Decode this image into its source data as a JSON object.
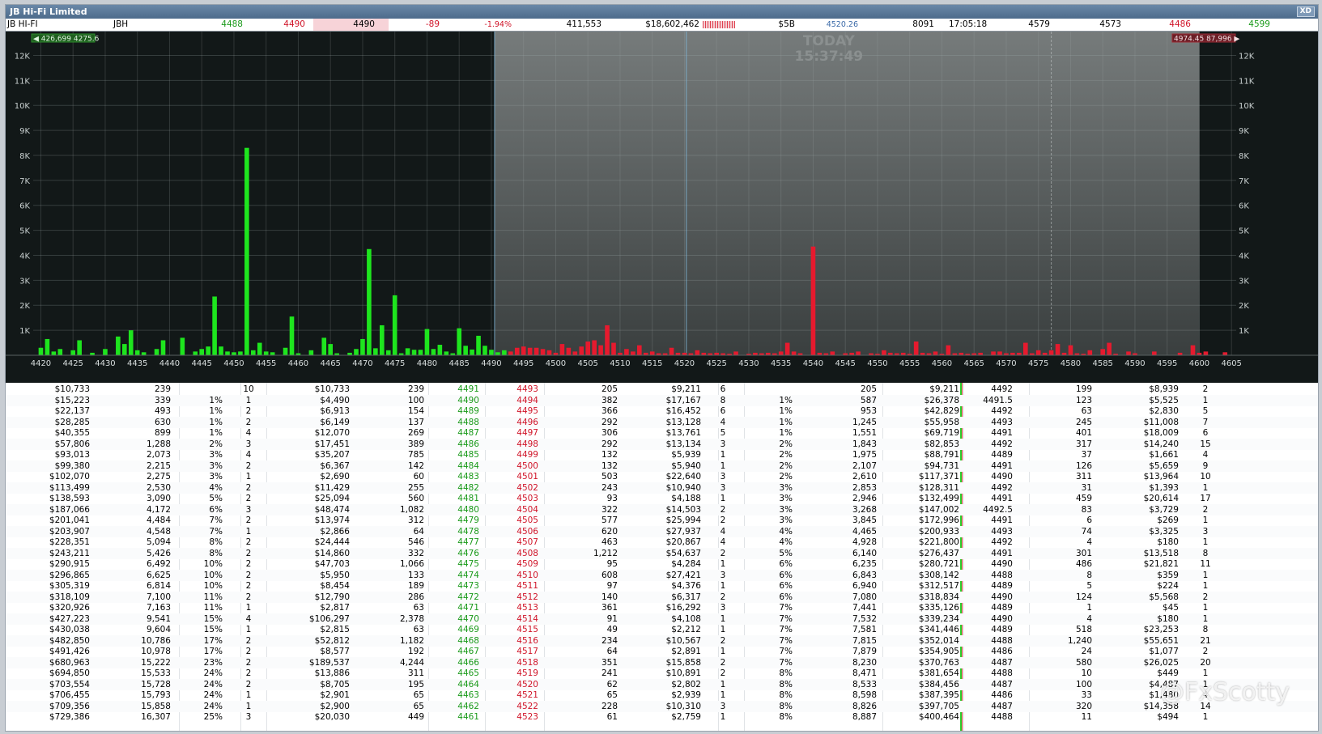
{
  "window": {
    "title": "JB Hi-Fi Limited",
    "xd_label": "XD"
  },
  "quote": {
    "name": "JB HI-FI",
    "code": "JBH",
    "bid": "4488",
    "ask": "4490",
    "last": "4490",
    "change": "-89",
    "change_pct": "-1.94%",
    "volume": "411,553",
    "value": "$18,602,462",
    "market_cap": "$5B",
    "vwap": "4520.26",
    "trades": "8091",
    "time": "17:05:18",
    "high": "4579",
    "open": "4573",
    "low": "4486",
    "prev_close": "4599"
  },
  "chart": {
    "today_label": "TODAY",
    "time_label": "15:37:49",
    "left_badge": "426,699 4275.6",
    "right_badge": "4974.45 87,996",
    "colors": {
      "buy": "#1ee51e",
      "sell": "#e61a2e",
      "bg": "#121818",
      "shade": "#6b7070"
    }
  },
  "chart_data": {
    "type": "bar",
    "x_range": [
      4419,
      4605
    ],
    "ylim": [
      0,
      12500
    ],
    "y_ticks": [
      1000,
      2000,
      3000,
      4000,
      5000,
      6000,
      7000,
      8000,
      9000,
      10000,
      11000,
      12000
    ],
    "y_tick_labels": [
      "1K",
      "2K",
      "3K",
      "4K",
      "5K",
      "6K",
      "7K",
      "8K",
      "9K",
      "10K",
      "11K",
      "12K"
    ],
    "x_ticks": [
      4420,
      4425,
      4430,
      4435,
      4440,
      4445,
      4450,
      4455,
      4460,
      4465,
      4470,
      4475,
      4480,
      4485,
      4490,
      4495,
      4500,
      4505,
      4510,
      4515,
      4520,
      4525,
      4530,
      4535,
      4540,
      4545,
      4550,
      4555,
      4560,
      4565,
      4570,
      4575,
      4580,
      4585,
      4590,
      4595,
      4600,
      4605
    ],
    "shaded_range": [
      4490.5,
      4600
    ],
    "vline_prices": [
      4490.5,
      4520.3
    ],
    "grid": true,
    "series": [
      {
        "side": "buy",
        "points": [
          [
            4420,
            300
          ],
          [
            4421,
            650
          ],
          [
            4422,
            150
          ],
          [
            4423,
            250
          ],
          [
            4425,
            200
          ],
          [
            4426,
            600
          ],
          [
            4428,
            100
          ],
          [
            4430,
            250
          ],
          [
            4432,
            750
          ],
          [
            4433,
            450
          ],
          [
            4434,
            1000
          ],
          [
            4435,
            200
          ],
          [
            4436,
            120
          ],
          [
            4438,
            250
          ],
          [
            4439,
            600
          ],
          [
            4442,
            700
          ],
          [
            4444,
            150
          ],
          [
            4445,
            250
          ],
          [
            4446,
            350
          ],
          [
            4447,
            2350
          ],
          [
            4448,
            350
          ],
          [
            4449,
            150
          ],
          [
            4450,
            120
          ],
          [
            4451,
            150
          ],
          [
            4452,
            8300
          ],
          [
            4453,
            200
          ],
          [
            4454,
            500
          ],
          [
            4455,
            150
          ],
          [
            4456,
            120
          ],
          [
            4458,
            300
          ],
          [
            4459,
            1550
          ],
          [
            4460,
            80
          ],
          [
            4462,
            200
          ],
          [
            4464,
            700
          ],
          [
            4465,
            450
          ],
          [
            4466,
            80
          ],
          [
            4468,
            100
          ],
          [
            4469,
            250
          ],
          [
            4470,
            650
          ],
          [
            4471,
            4250
          ],
          [
            4472,
            280
          ],
          [
            4473,
            1200
          ],
          [
            4474,
            200
          ],
          [
            4475,
            2400
          ],
          [
            4476,
            80
          ],
          [
            4477,
            280
          ],
          [
            4478,
            220
          ],
          [
            4479,
            220
          ],
          [
            4480,
            1050
          ],
          [
            4481,
            250
          ],
          [
            4482,
            420
          ],
          [
            4483,
            150
          ],
          [
            4484,
            80
          ],
          [
            4485,
            1080
          ],
          [
            4486,
            380
          ],
          [
            4487,
            230
          ],
          [
            4488,
            780
          ],
          [
            4489,
            380
          ],
          [
            4490,
            220
          ],
          [
            4491,
            120
          ],
          [
            4492,
            200
          ],
          [
            4493,
            120
          ],
          [
            4494,
            200
          ]
        ]
      },
      {
        "side": "sell",
        "points": [
          [
            4493,
            150
          ],
          [
            4494,
            300
          ],
          [
            4495,
            350
          ],
          [
            4496,
            300
          ],
          [
            4497,
            300
          ],
          [
            4498,
            250
          ],
          [
            4499,
            200
          ],
          [
            4500,
            100
          ],
          [
            4501,
            450
          ],
          [
            4502,
            300
          ],
          [
            4503,
            150
          ],
          [
            4504,
            350
          ],
          [
            4505,
            550
          ],
          [
            4506,
            600
          ],
          [
            4507,
            400
          ],
          [
            4508,
            1200
          ],
          [
            4509,
            500
          ],
          [
            4510,
            100
          ],
          [
            4511,
            250
          ],
          [
            4512,
            150
          ],
          [
            4513,
            400
          ],
          [
            4514,
            100
          ],
          [
            4515,
            150
          ],
          [
            4516,
            80
          ],
          [
            4517,
            80
          ],
          [
            4518,
            300
          ],
          [
            4519,
            100
          ],
          [
            4520,
            100
          ],
          [
            4521,
            80
          ],
          [
            4522,
            200
          ],
          [
            4523,
            100
          ],
          [
            4524,
            80
          ],
          [
            4525,
            100
          ],
          [
            4526,
            80
          ],
          [
            4527,
            60
          ],
          [
            4528,
            150
          ],
          [
            4530,
            60
          ],
          [
            4531,
            100
          ],
          [
            4532,
            80
          ],
          [
            4533,
            100
          ],
          [
            4534,
            80
          ],
          [
            4535,
            150
          ],
          [
            4536,
            500
          ],
          [
            4537,
            150
          ],
          [
            4538,
            80
          ],
          [
            4540,
            4350
          ],
          [
            4541,
            100
          ],
          [
            4542,
            80
          ],
          [
            4543,
            150
          ],
          [
            4545,
            80
          ],
          [
            4546,
            100
          ],
          [
            4547,
            150
          ],
          [
            4549,
            80
          ],
          [
            4550,
            60
          ],
          [
            4551,
            200
          ],
          [
            4552,
            100
          ],
          [
            4553,
            80
          ],
          [
            4554,
            100
          ],
          [
            4555,
            60
          ],
          [
            4556,
            550
          ],
          [
            4557,
            100
          ],
          [
            4558,
            80
          ],
          [
            4559,
            150
          ],
          [
            4560,
            60
          ],
          [
            4561,
            400
          ],
          [
            4562,
            80
          ],
          [
            4563,
            100
          ],
          [
            4564,
            60
          ],
          [
            4565,
            80
          ],
          [
            4566,
            100
          ],
          [
            4568,
            150
          ],
          [
            4569,
            150
          ],
          [
            4570,
            80
          ],
          [
            4571,
            100
          ],
          [
            4572,
            100
          ],
          [
            4573,
            500
          ],
          [
            4574,
            80
          ],
          [
            4575,
            200
          ],
          [
            4576,
            100
          ],
          [
            4577,
            200
          ],
          [
            4578,
            450
          ],
          [
            4579,
            100
          ],
          [
            4580,
            400
          ],
          [
            4581,
            80
          ],
          [
            4582,
            60
          ],
          [
            4583,
            200
          ],
          [
            4585,
            250
          ],
          [
            4586,
            500
          ],
          [
            4587,
            60
          ],
          [
            4589,
            150
          ],
          [
            4590,
            80
          ],
          [
            4593,
            150
          ],
          [
            4597,
            100
          ],
          [
            4599,
            400
          ],
          [
            4600,
            100
          ],
          [
            4601,
            150
          ],
          [
            4604,
            120
          ]
        ]
      }
    ]
  },
  "table_rows": [
    [
      "$10,733",
      "239",
      "",
      "10",
      "$10,733",
      "239",
      "4491",
      "4493",
      "205",
      "$9,211",
      "6",
      "",
      "205",
      "$9,211",
      "4492",
      "199",
      "$8,939",
      "2"
    ],
    [
      "$15,223",
      "339",
      "1%",
      "1",
      "$4,490",
      "100",
      "4490",
      "4494",
      "382",
      "$17,167",
      "8",
      "1%",
      "587",
      "$26,378",
      "4491.5",
      "123",
      "$5,525",
      "1"
    ],
    [
      "$22,137",
      "493",
      "1%",
      "2",
      "$6,913",
      "154",
      "4489",
      "4495",
      "366",
      "$16,452",
      "6",
      "1%",
      "953",
      "$42,829",
      "4492",
      "63",
      "$2,830",
      "5"
    ],
    [
      "$28,285",
      "630",
      "1%",
      "2",
      "$6,149",
      "137",
      "4488",
      "4496",
      "292",
      "$13,128",
      "4",
      "1%",
      "1,245",
      "$55,958",
      "4493",
      "245",
      "$11,008",
      "7"
    ],
    [
      "$40,355",
      "899",
      "1%",
      "4",
      "$12,070",
      "269",
      "4487",
      "4497",
      "306",
      "$13,761",
      "5",
      "1%",
      "1,551",
      "$69,719",
      "4491",
      "401",
      "$18,009",
      "6"
    ],
    [
      "$57,806",
      "1,288",
      "2%",
      "3",
      "$17,451",
      "389",
      "4486",
      "4498",
      "292",
      "$13,134",
      "3",
      "2%",
      "1,843",
      "$82,853",
      "4492",
      "317",
      "$14,240",
      "15"
    ],
    [
      "$93,013",
      "2,073",
      "3%",
      "4",
      "$35,207",
      "785",
      "4485",
      "4499",
      "132",
      "$5,939",
      "1",
      "2%",
      "1,975",
      "$88,791",
      "4489",
      "37",
      "$1,661",
      "4"
    ],
    [
      "$99,380",
      "2,215",
      "3%",
      "2",
      "$6,367",
      "142",
      "4484",
      "4500",
      "132",
      "$5,940",
      "1",
      "2%",
      "2,107",
      "$94,731",
      "4491",
      "126",
      "$5,659",
      "9"
    ],
    [
      "$102,070",
      "2,275",
      "3%",
      "1",
      "$2,690",
      "60",
      "4483",
      "4501",
      "503",
      "$22,640",
      "3",
      "2%",
      "2,610",
      "$117,371",
      "4490",
      "311",
      "$13,964",
      "10"
    ],
    [
      "$113,499",
      "2,530",
      "4%",
      "2",
      "$11,429",
      "255",
      "4482",
      "4502",
      "243",
      "$10,940",
      "3",
      "3%",
      "2,853",
      "$128,311",
      "4492",
      "31",
      "$1,393",
      "1"
    ],
    [
      "$138,593",
      "3,090",
      "5%",
      "2",
      "$25,094",
      "560",
      "4481",
      "4503",
      "93",
      "$4,188",
      "1",
      "3%",
      "2,946",
      "$132,499",
      "4491",
      "459",
      "$20,614",
      "17"
    ],
    [
      "$187,066",
      "4,172",
      "6%",
      "3",
      "$48,474",
      "1,082",
      "4480",
      "4504",
      "322",
      "$14,503",
      "2",
      "3%",
      "3,268",
      "$147,002",
      "4492.5",
      "83",
      "$3,729",
      "2"
    ],
    [
      "$201,041",
      "4,484",
      "7%",
      "2",
      "$13,974",
      "312",
      "4479",
      "4505",
      "577",
      "$25,994",
      "2",
      "3%",
      "3,845",
      "$172,996",
      "4491",
      "6",
      "$269",
      "1"
    ],
    [
      "$203,907",
      "4,548",
      "7%",
      "1",
      "$2,866",
      "64",
      "4478",
      "4506",
      "620",
      "$27,937",
      "4",
      "4%",
      "4,465",
      "$200,933",
      "4493",
      "74",
      "$3,325",
      "3"
    ],
    [
      "$228,351",
      "5,094",
      "8%",
      "2",
      "$24,444",
      "546",
      "4477",
      "4507",
      "463",
      "$20,867",
      "4",
      "4%",
      "4,928",
      "$221,800",
      "4492",
      "4",
      "$180",
      "1"
    ],
    [
      "$243,211",
      "5,426",
      "8%",
      "2",
      "$14,860",
      "332",
      "4476",
      "4508",
      "1,212",
      "$54,637",
      "2",
      "5%",
      "6,140",
      "$276,437",
      "4491",
      "301",
      "$13,518",
      "8"
    ],
    [
      "$290,915",
      "6,492",
      "10%",
      "2",
      "$47,703",
      "1,066",
      "4475",
      "4509",
      "95",
      "$4,284",
      "1",
      "6%",
      "6,235",
      "$280,721",
      "4490",
      "486",
      "$21,821",
      "11"
    ],
    [
      "$296,865",
      "6,625",
      "10%",
      "2",
      "$5,950",
      "133",
      "4474",
      "4510",
      "608",
      "$27,421",
      "3",
      "6%",
      "6,843",
      "$308,142",
      "4488",
      "8",
      "$359",
      "1"
    ],
    [
      "$305,319",
      "6,814",
      "10%",
      "2",
      "$8,454",
      "189",
      "4473",
      "4511",
      "97",
      "$4,376",
      "1",
      "6%",
      "6,940",
      "$312,517",
      "4489",
      "5",
      "$224",
      "1"
    ],
    [
      "$318,109",
      "7,100",
      "11%",
      "2",
      "$12,790",
      "286",
      "4472",
      "4512",
      "140",
      "$6,317",
      "2",
      "6%",
      "7,080",
      "$318,834",
      "4490",
      "124",
      "$5,568",
      "2"
    ],
    [
      "$320,926",
      "7,163",
      "11%",
      "1",
      "$2,817",
      "63",
      "4471",
      "4513",
      "361",
      "$16,292",
      "3",
      "7%",
      "7,441",
      "$335,126",
      "4489",
      "1",
      "$45",
      "1"
    ],
    [
      "$427,223",
      "9,541",
      "15%",
      "4",
      "$106,297",
      "2,378",
      "4470",
      "4514",
      "91",
      "$4,108",
      "1",
      "7%",
      "7,532",
      "$339,234",
      "4490",
      "4",
      "$180",
      "1"
    ],
    [
      "$430,038",
      "9,604",
      "15%",
      "1",
      "$2,815",
      "63",
      "4469",
      "4515",
      "49",
      "$2,212",
      "1",
      "7%",
      "7,581",
      "$341,446",
      "4489",
      "518",
      "$23,253",
      "8"
    ],
    [
      "$482,850",
      "10,786",
      "17%",
      "2",
      "$52,812",
      "1,182",
      "4468",
      "4516",
      "234",
      "$10,567",
      "2",
      "7%",
      "7,815",
      "$352,014",
      "4488",
      "1,240",
      "$55,651",
      "21"
    ],
    [
      "$491,426",
      "10,978",
      "17%",
      "2",
      "$8,577",
      "192",
      "4467",
      "4517",
      "64",
      "$2,891",
      "1",
      "7%",
      "7,879",
      "$354,905",
      "4486",
      "24",
      "$1,077",
      "2"
    ],
    [
      "$680,963",
      "15,222",
      "23%",
      "2",
      "$189,537",
      "4,244",
      "4466",
      "4518",
      "351",
      "$15,858",
      "2",
      "7%",
      "8,230",
      "$370,763",
      "4487",
      "580",
      "$26,025",
      "20"
    ],
    [
      "$694,850",
      "15,533",
      "24%",
      "2",
      "$13,886",
      "311",
      "4465",
      "4519",
      "241",
      "$10,891",
      "2",
      "8%",
      "8,471",
      "$381,654",
      "4488",
      "10",
      "$449",
      "1"
    ],
    [
      "$703,554",
      "15,728",
      "24%",
      "2",
      "$8,705",
      "195",
      "4464",
      "4520",
      "62",
      "$2,802",
      "1",
      "8%",
      "8,533",
      "$384,456",
      "4487",
      "100",
      "$4,487",
      "1"
    ],
    [
      "$706,455",
      "15,793",
      "24%",
      "1",
      "$2,901",
      "65",
      "4463",
      "4521",
      "65",
      "$2,939",
      "1",
      "8%",
      "8,598",
      "$387,395",
      "4486",
      "33",
      "$1,480",
      "4"
    ],
    [
      "$709,356",
      "15,858",
      "24%",
      "1",
      "$2,900",
      "65",
      "4462",
      "4522",
      "228",
      "$10,310",
      "3",
      "8%",
      "8,826",
      "$397,705",
      "4487",
      "320",
      "$14,358",
      "14"
    ],
    [
      "$729,386",
      "16,307",
      "25%",
      "3",
      "$20,030",
      "449",
      "4461",
      "4523",
      "61",
      "$2,759",
      "1",
      "8%",
      "8,887",
      "$400,464",
      "4488",
      "11",
      "$494",
      "1"
    ]
  ],
  "watermark": "@FxScotty"
}
